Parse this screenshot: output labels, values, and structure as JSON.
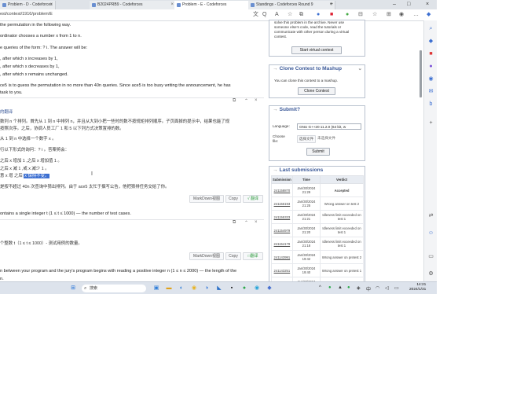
{
  "tabs": [
    {
      "title": "Problem - D - Codeforces",
      "active": false
    },
    {
      "title": "B2024PRB9 - Codeforces",
      "active": false
    },
    {
      "title": "Problem - E - Codeforces",
      "active": true
    },
    {
      "title": "Standings - Codeforces Round 9",
      "active": false
    }
  ],
  "address": {
    "url": "est/contest/1916/problem/E"
  },
  "statement": {
    "line1": "the permutation in the following way.",
    "line2": "ordinator chooses a number x from 1 to n.",
    "line3": "e queries of the form: ? i. The answer will be:",
    "bullet1": ", after which x increases by 1,",
    "bullet2": ", after which x decreases by 1,",
    "bullet3": ", after which x remains unchanged.",
    "line4": "ce5 is to guess the permutation in no more than 40n queries. Since ace5 is too busy writing the announcement, he has",
    "line5": "task to you."
  },
  "translation1": {
    "header_icons": [
      "copy-icon",
      "collapse-icon",
      "close-icon"
    ],
    "label": "的翻译",
    "cn1": "数列 n 个排列。首先从 1 到 n 中排列  n，并且从大到小把一些时的数不按规矩排列顺序。子页面掉的提示中，结果也能了规",
    "cn2": "按照次序。之后，协调人员工厂 1 和 5 以下列方式决策置排的数。",
    "cn3": "从 1 到 n 中选择一个数字 x 。",
    "cn4": "行以下形式的询问：? i 。答案将会：",
    "cn5": "之后 x 增加 1 ,之后 x 增加值 1 。",
    "cn6": "之后 x 减 1 ,或 x 减少 1 。",
    "cn7_pre": "意  x 增  之后",
    "cn7_hl": "x 保持不变。",
    "cn8": "是按不超过 40n 次查询中猜出排列。由于 ace5 太忙于撰写公告，他把猜排任务交给了你。",
    "buttons": [
      "MarkDown视图",
      "Copy",
      "√ 翻译"
    ]
  },
  "input_section": {
    "text": "ontains a single integer t (1 ≤ t ≤ 1000) — the number of test cases."
  },
  "translation2": {
    "cn": "个整数 t（1 ≤ t ≤ 1000）- 测试用例的数量。",
    "buttons": [
      "MarkDown视图",
      "Copy",
      "□翻译"
    ]
  },
  "footer_text": {
    "line1": "n between your program and the jury's program begins with reading a positive integer n (1 ≤ n ≤ 2000) — the length of the",
    "line2": "n."
  },
  "right_column": {
    "virtual": {
      "text": "solve this problem in the archive. Never use someone else's code, read the tutorials or communicate with other person during a virtual contest.",
      "button": "Start virtual contest"
    },
    "mashup": {
      "title": "Clone Contest to Mashup",
      "text": "You can clone this contest to a mashup.",
      "button": "Clone Contest"
    },
    "submit": {
      "title": "Submit?",
      "language_label": "Language:",
      "language_value": "GNU G++20 11.2.0 (64 bit, w",
      "file_label": "Choose file:",
      "file_button": "选择文件",
      "file_value": "未选择文件",
      "submit_button": "Submit"
    },
    "last_submissions": {
      "title": "Last submissions",
      "columns": [
        "Submission",
        "Time",
        "Verdict"
      ],
      "rows": [
        {
          "id": "241158870",
          "time": "Jan/30/2024 21:29",
          "verdict": "Accepted",
          "kind": "acc"
        },
        {
          "id": "241156193",
          "time": "Jan/30/2024 21:25",
          "verdict": "Wrong answer on test 2",
          "kind": "wa"
        },
        {
          "id": "241155333",
          "time": "Jan/30/2024 21:21",
          "verdict": "Idleness limit exceeded on test 1",
          "kind": "wa"
        },
        {
          "id": "241154979",
          "time": "Jan/30/2024 21:20",
          "verdict": "Idleness limit exceeded on test 1",
          "kind": "wa"
        },
        {
          "id": "241154179",
          "time": "Jan/30/2024 21:18",
          "verdict": "Idleness limit exceeded on test 1",
          "kind": "wa"
        },
        {
          "id": "241143991",
          "time": "Jan/30/2024 19:42",
          "verdict": "Wrong answer on pretest 2",
          "kind": "wa"
        },
        {
          "id": "241143251",
          "time": "Jan/30/2024 19:40",
          "verdict": "Wrong answer on pretest 1",
          "kind": "wa"
        },
        {
          "id": "241140270",
          "time": "Jan/30/2024 19:37",
          "verdict": "Time limit exceeded on",
          "kind": "wa"
        }
      ]
    }
  },
  "taskbar": {
    "search_placeholder": "搜索",
    "time": "14:21",
    "date": "2024/1/31"
  }
}
